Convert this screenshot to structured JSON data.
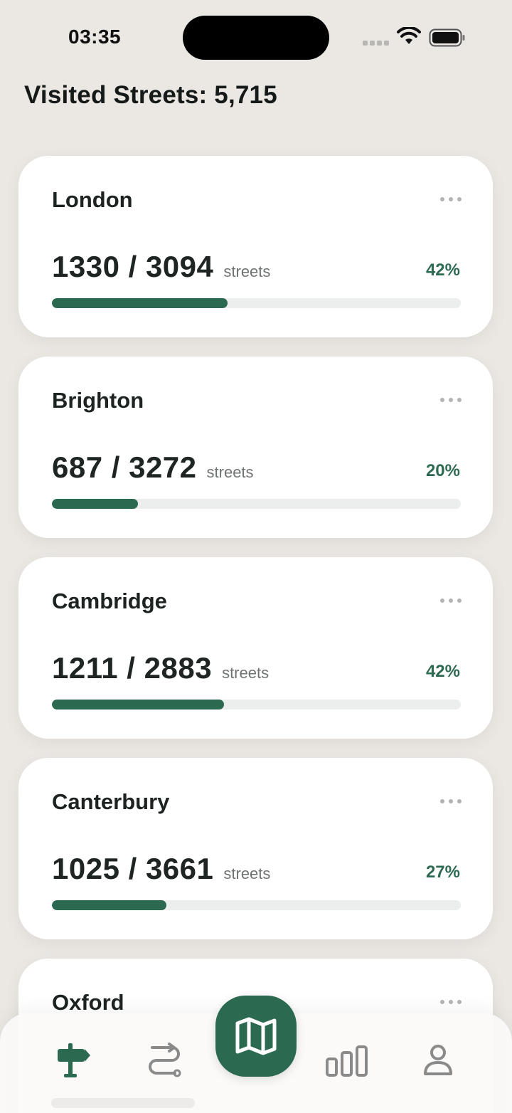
{
  "status_bar": {
    "time": "03:35"
  },
  "header": {
    "title": "Visited Streets: 5,715"
  },
  "cities": [
    {
      "name": "London",
      "visited": "1330",
      "total": "3094",
      "count_text": "1330 / 3094",
      "unit": "streets",
      "percent_text": "42%",
      "progress": 0.43
    },
    {
      "name": "Brighton",
      "visited": "687",
      "total": "3272",
      "count_text": "687 / 3272",
      "unit": "streets",
      "percent_text": "20%",
      "progress": 0.21
    },
    {
      "name": "Cambridge",
      "visited": "1211",
      "total": "2883",
      "count_text": "1211 / 2883",
      "unit": "streets",
      "percent_text": "42%",
      "progress": 0.42
    },
    {
      "name": "Canterbury",
      "visited": "1025",
      "total": "3661",
      "count_text": "1025 / 3661",
      "unit": "streets",
      "percent_text": "27%",
      "progress": 0.28
    },
    {
      "name": "Oxford"
    }
  ],
  "tabbar": {
    "tabs": [
      {
        "id": "places",
        "icon": "signpost-icon"
      },
      {
        "id": "routes",
        "icon": "route-icon"
      },
      {
        "id": "map",
        "icon": "map-icon"
      },
      {
        "id": "stats",
        "icon": "bar-chart-icon"
      },
      {
        "id": "profile",
        "icon": "person-icon"
      }
    ]
  },
  "colors": {
    "accent": "#2b6a51",
    "track": "#ebeeec",
    "background": "#ebe8e4",
    "card": "#ffffff"
  }
}
